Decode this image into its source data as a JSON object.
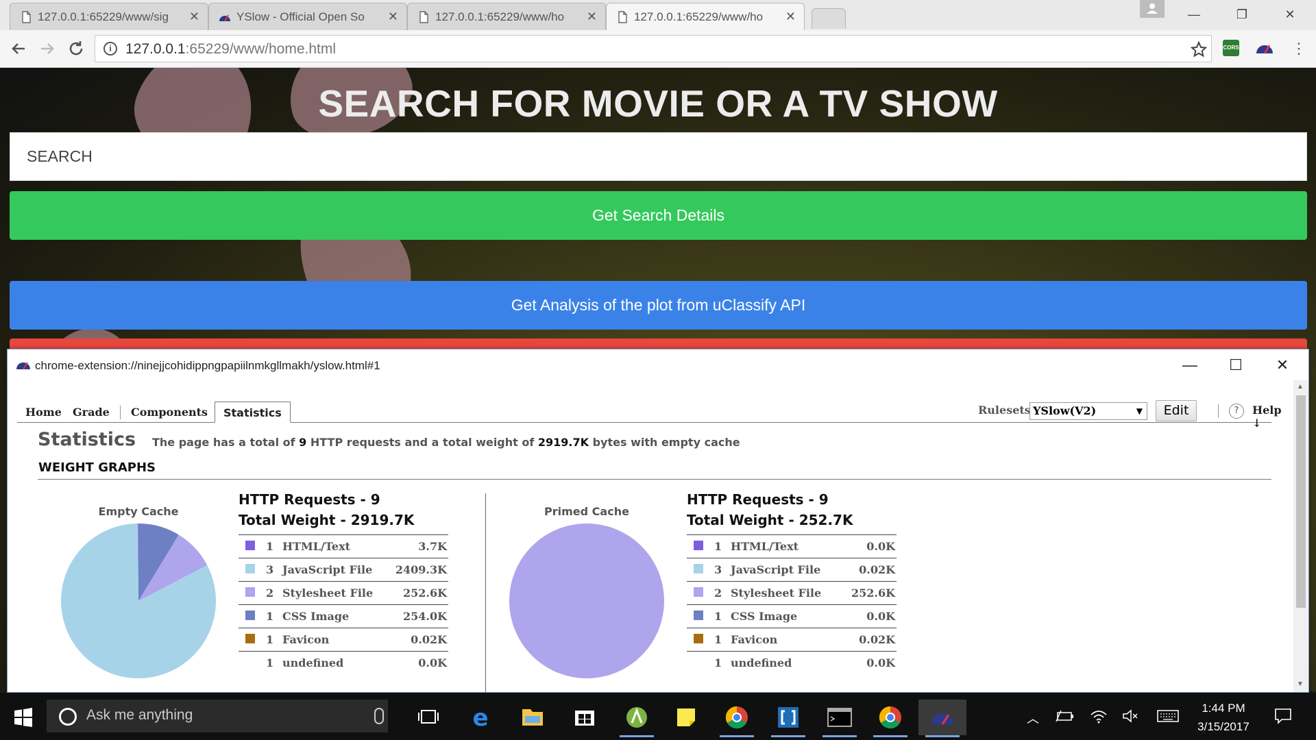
{
  "browser": {
    "tabs": [
      {
        "title": "127.0.0.1:65229/www/sig",
        "icon": "page-icon",
        "active": false
      },
      {
        "title": "YSlow - Official Open So",
        "icon": "yslow-icon",
        "active": false
      },
      {
        "title": "127.0.0.1:65229/www/ho",
        "icon": "page-icon",
        "active": false
      },
      {
        "title": "127.0.0.1:65229/www/ho",
        "icon": "page-icon",
        "active": true
      }
    ],
    "url_host": "127.0.0.1",
    "url_rest": ":65229/www/home.html",
    "extensions": [
      "cors-icon",
      "yslow-icon"
    ]
  },
  "page": {
    "heading": "SEARCH FOR MOVIE OR A TV SHOW",
    "search_placeholder": "SEARCH",
    "btn_details": "Get Search Details",
    "btn_analysis": "Get Analysis of the plot from uClassify API",
    "colors": {
      "green": "#35c95d",
      "blue": "#3b82e8",
      "red": "#e8473c"
    }
  },
  "yslow": {
    "window_title": "chrome-extension://ninejjcohidippngpapiilnmkgllmakh/yslow.html#1",
    "tabs": [
      "Home",
      "Grade",
      "Components",
      "Statistics"
    ],
    "selected_tab": "Statistics",
    "rulesets_label": "Rulesets",
    "ruleset_value": "YSlow(V2)",
    "edit_label": "Edit",
    "help_label": "Help ↓",
    "stats_title": "Statistics",
    "summary": {
      "part1": "The page has a total of ",
      "requests": "9",
      "part2": " HTTP requests and a total weight of ",
      "weight": "2919.7K",
      "part3": " bytes with empty cache"
    },
    "weight_graphs_title": "WEIGHT GRAPHS",
    "empty": {
      "label": "Empty Cache",
      "requests_title": "HTTP Requests - 9",
      "weight_title": "Total Weight - 2919.7K",
      "rows": [
        {
          "count": "1",
          "type": "HTML/Text",
          "weight": "3.7K",
          "color": "#7f5ee0"
        },
        {
          "count": "3",
          "type": "JavaScript File",
          "weight": "2409.3K",
          "color": "#a7d3e9"
        },
        {
          "count": "2",
          "type": "Stylesheet File",
          "weight": "252.6K",
          "color": "#aea5ec"
        },
        {
          "count": "1",
          "type": "CSS Image",
          "weight": "254.0K",
          "color": "#6e80c4"
        },
        {
          "count": "1",
          "type": "Favicon",
          "weight": "0.02K",
          "color": "#a86d10"
        },
        {
          "count": "1",
          "type": "undefined",
          "weight": "0.0K",
          "color": "#ffffff"
        }
      ]
    },
    "primed": {
      "label": "Primed Cache",
      "requests_title": "HTTP Requests - 9",
      "weight_title": "Total Weight - 252.7K",
      "rows": [
        {
          "count": "1",
          "type": "HTML/Text",
          "weight": "0.0K",
          "color": "#7f5ee0"
        },
        {
          "count": "3",
          "type": "JavaScript File",
          "weight": "0.02K",
          "color": "#a7d3e9"
        },
        {
          "count": "2",
          "type": "Stylesheet File",
          "weight": "252.6K",
          "color": "#aea5ec"
        },
        {
          "count": "1",
          "type": "CSS Image",
          "weight": "0.0K",
          "color": "#6e80c4"
        },
        {
          "count": "1",
          "type": "Favicon",
          "weight": "0.02K",
          "color": "#a86d10"
        },
        {
          "count": "1",
          "type": "undefined",
          "weight": "0.0K",
          "color": "#ffffff"
        }
      ]
    }
  },
  "chart_data": [
    {
      "type": "pie",
      "title": "Empty Cache",
      "categories": [
        "HTML/Text",
        "JavaScript File",
        "Stylesheet File",
        "CSS Image",
        "Favicon",
        "undefined"
      ],
      "values": [
        3.7,
        2409.3,
        252.6,
        254.0,
        0.02,
        0.0
      ],
      "colors": [
        "#7f5ee0",
        "#a7d3e9",
        "#aea5ec",
        "#6e80c4",
        "#a86d10",
        "#ffffff"
      ]
    },
    {
      "type": "pie",
      "title": "Primed Cache",
      "categories": [
        "HTML/Text",
        "JavaScript File",
        "Stylesheet File",
        "CSS Image",
        "Favicon",
        "undefined"
      ],
      "values": [
        0.0,
        0.02,
        252.6,
        0.0,
        0.02,
        0.0
      ],
      "colors": [
        "#7f5ee0",
        "#a7d3e9",
        "#aea5ec",
        "#6e80c4",
        "#a86d10",
        "#ffffff"
      ]
    }
  ],
  "taskbar": {
    "search_placeholder": "Ask me anything",
    "time": "1:44 PM",
    "date": "3/15/2017",
    "apps": [
      "task-view-icon",
      "edge-icon",
      "file-explorer-icon",
      "store-icon",
      "android-studio-icon",
      "sticky-notes-icon",
      "chrome-icon",
      "brackets-icon",
      "terminal-icon",
      "chrome-icon",
      "yslow-icon"
    ]
  }
}
